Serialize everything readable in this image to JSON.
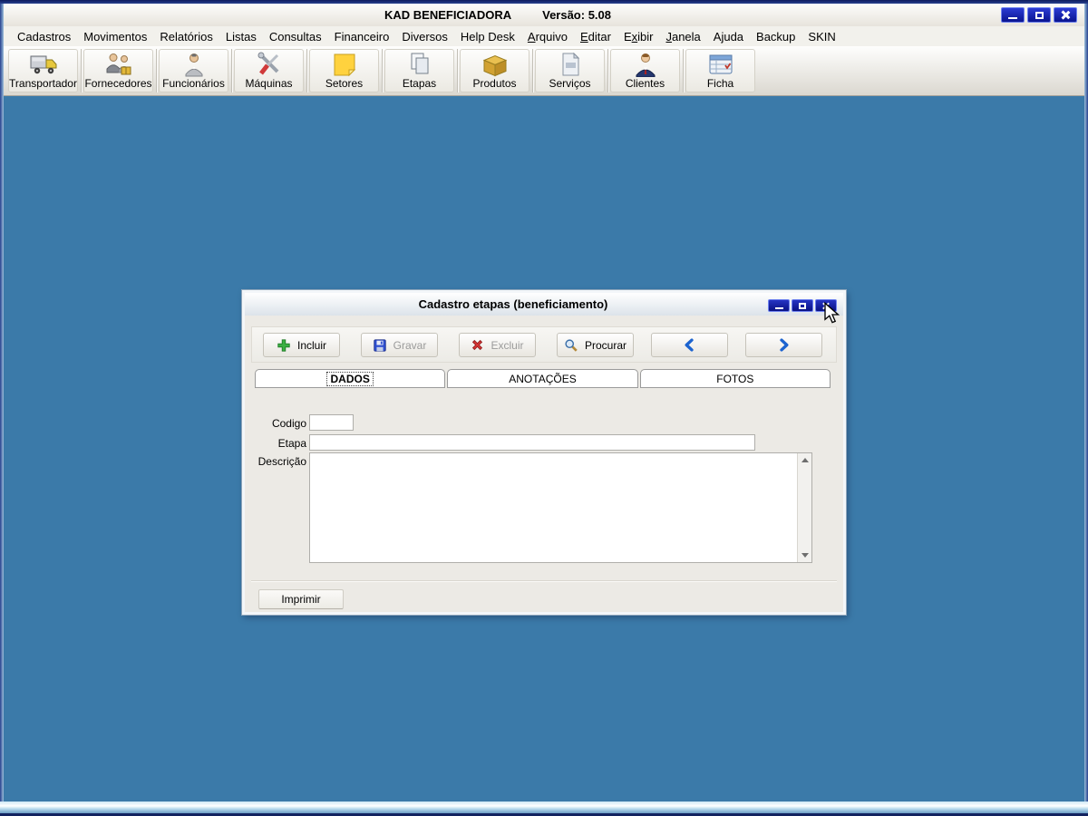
{
  "window": {
    "title": "KAD BENEFICIADORA",
    "version": "Versão: 5.08"
  },
  "menu": {
    "items": [
      {
        "pre": "Cadastros",
        "key": "",
        "post": ""
      },
      {
        "pre": "Movimentos",
        "key": "",
        "post": ""
      },
      {
        "pre": "Relatórios",
        "key": "",
        "post": ""
      },
      {
        "pre": "Listas",
        "key": "",
        "post": ""
      },
      {
        "pre": "Consultas",
        "key": "",
        "post": ""
      },
      {
        "pre": "Financeiro",
        "key": "",
        "post": ""
      },
      {
        "pre": "Diversos",
        "key": "",
        "post": ""
      },
      {
        "pre": "Help Desk",
        "key": "",
        "post": ""
      },
      {
        "pre": "",
        "key": "A",
        "post": "rquivo"
      },
      {
        "pre": "",
        "key": "E",
        "post": "ditar"
      },
      {
        "pre": "E",
        "key": "x",
        "post": "ibir"
      },
      {
        "pre": "",
        "key": "J",
        "post": "anela"
      },
      {
        "pre": "Ajuda",
        "key": "",
        "post": ""
      },
      {
        "pre": "Backup",
        "key": "",
        "post": ""
      },
      {
        "pre": "SKIN",
        "key": "",
        "post": ""
      }
    ]
  },
  "toolbar": {
    "items": [
      {
        "label": "Transportador",
        "icon": "truck-icon"
      },
      {
        "label": "Fornecedores",
        "icon": "suppliers-people-icon"
      },
      {
        "label": "Funcionários",
        "icon": "employee-person-icon"
      },
      {
        "label": "Máquinas",
        "icon": "tools-icon"
      },
      {
        "label": "Setores",
        "icon": "sticky-note-icon"
      },
      {
        "label": "Etapas",
        "icon": "pages-icon"
      },
      {
        "label": "Produtos",
        "icon": "box-icon"
      },
      {
        "label": "Serviços",
        "icon": "document-icon"
      },
      {
        "label": "Clientes",
        "icon": "client-person-icon"
      },
      {
        "label": "Ficha",
        "icon": "record-card-icon"
      }
    ]
  },
  "dialog": {
    "title": "Cadastro etapas (beneficiamento)",
    "toolbar": {
      "incluir": {
        "label": "Incluir",
        "disabled": false,
        "icon": "plus-icon"
      },
      "gravar": {
        "label": "Gravar",
        "disabled": true,
        "icon": "floppy-icon"
      },
      "excluir": {
        "label": "Excluir",
        "disabled": true,
        "icon": "red-x-icon"
      },
      "procurar": {
        "label": "Procurar",
        "disabled": false,
        "icon": "magnifier-icon"
      },
      "prev_icon": "chevron-left-icon",
      "next_icon": "chevron-right-icon"
    },
    "tabs": [
      {
        "label": "DADOS"
      },
      {
        "label": "ANOTAÇÕES"
      },
      {
        "label": "FOTOS"
      }
    ],
    "form": {
      "codigo_label": "Codigo",
      "codigo_value": "",
      "etapa_label": "Etapa",
      "etapa_value": "",
      "descricao_label": "Descrição",
      "descricao_value": ""
    },
    "imprimir_label": "Imprimir"
  },
  "colors": {
    "desktop_blue": "#3b7aa9",
    "control_navy": "#0a1490",
    "chrome_gray": "#ece9e2",
    "disabled_text": "#9b9b9b",
    "incluir_green": "#3cb043",
    "gravar_blue": "#2e4fd0",
    "excluir_red": "#d63434",
    "arrow_blue": "#1c63cf"
  }
}
